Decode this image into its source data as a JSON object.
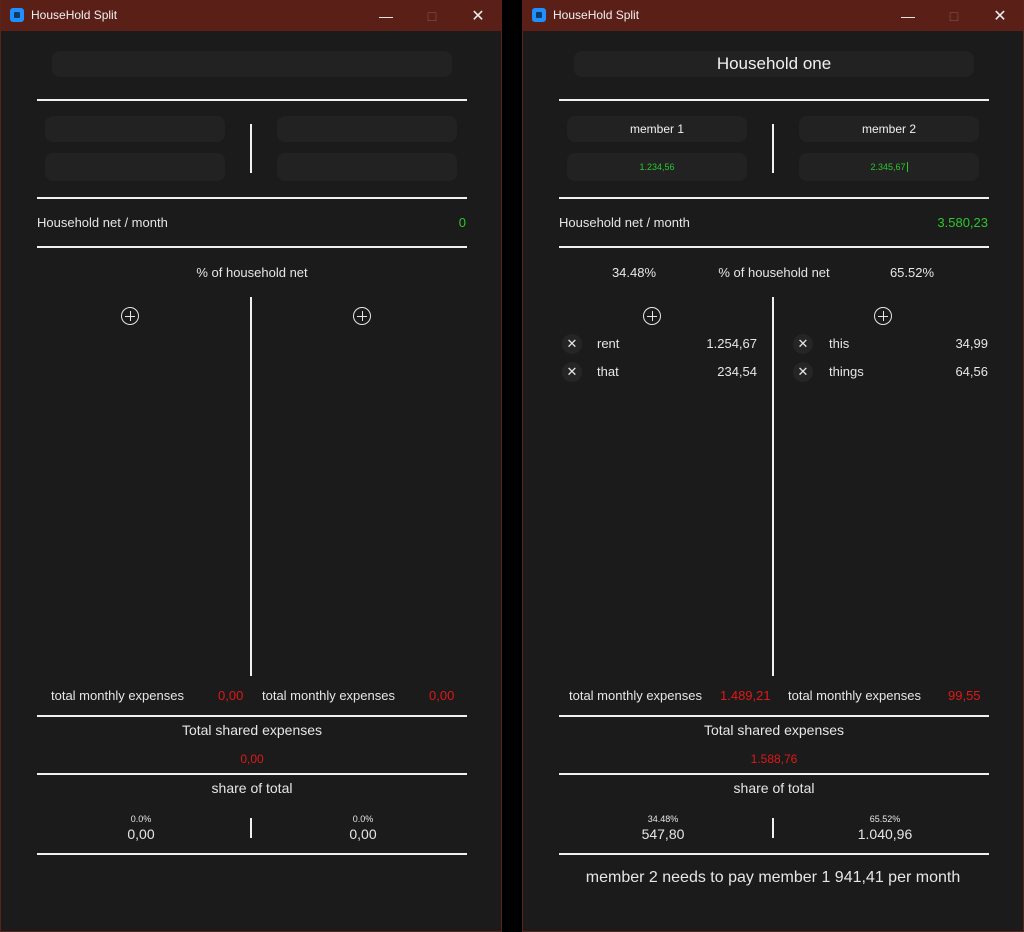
{
  "window": {
    "title": "HouseHold Split",
    "controls": {
      "minimize": "—",
      "maximize": "□",
      "close": "✕"
    }
  },
  "left": {
    "household_name": "",
    "member1": {
      "name": "",
      "net": ""
    },
    "member2": {
      "name": "",
      "net": ""
    },
    "household_net_label": "Household net / month",
    "household_net_value": "0",
    "pct_member1": "",
    "pct_label": "% of household net",
    "pct_member2": "",
    "expenses_member1": [],
    "expenses_member2": [],
    "total_monthly_label": "total monthly expenses",
    "total_member1": "0,00",
    "total_member2": "0,00",
    "total_shared_label": "Total shared expenses",
    "total_shared_value": "0,00",
    "share_label": "share of total",
    "share_member1_pct": "0.0%",
    "share_member1_value": "0,00",
    "share_member2_pct": "0.0%",
    "share_member2_value": "0,00",
    "settlement": ""
  },
  "right": {
    "household_name": "Household one",
    "member1": {
      "name": "member 1",
      "net": "1.234,56"
    },
    "member2": {
      "name": "member 2",
      "net": "2.345,67"
    },
    "household_net_label": "Household net / month",
    "household_net_value": "3.580,23",
    "pct_member1": "34.48%",
    "pct_label": "% of household net",
    "pct_member2": "65.52%",
    "expenses_member1": [
      {
        "name": "rent",
        "amount": "1.254,67"
      },
      {
        "name": "that",
        "amount": "234,54"
      }
    ],
    "expenses_member2": [
      {
        "name": "this",
        "amount": "34,99"
      },
      {
        "name": "things",
        "amount": "64,56"
      }
    ],
    "total_monthly_label": "total monthly expenses",
    "total_member1": "1.489,21",
    "total_member2": "99,55",
    "total_shared_label": "Total shared expenses",
    "total_shared_value": "1.588,76",
    "share_label": "share of total",
    "share_member1_pct": "34.48%",
    "share_member1_value": "547,80",
    "share_member2_pct": "65.52%",
    "share_member2_value": "1.040,96",
    "settlement": "member 2 needs to pay member 1 941,41 per month"
  },
  "icons": {
    "add": "plus-circle-icon",
    "delete": "close-icon"
  },
  "colors": {
    "titlebar": "#5a1f16",
    "background": "#1b1b1b",
    "positive": "#2ec52e",
    "negative": "#e01818"
  }
}
